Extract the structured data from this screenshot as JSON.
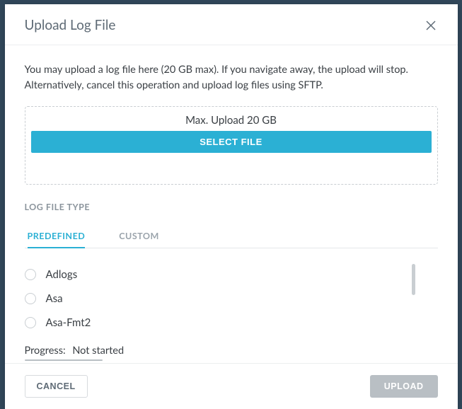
{
  "modal": {
    "title": "Upload Log File",
    "intro": "You may upload a log file here (20 GB max). If you navigate away, the upload will stop. Alternatively, cancel this operation and upload log files using SFTP.",
    "dropzone_hint": "Max. Upload 20 GB",
    "select_file_label": "SELECT FILE",
    "section_label": "LOG FILE TYPE",
    "tabs": {
      "predefined": "PREDEFINED",
      "custom": "CUSTOM"
    },
    "options": {
      "0": "Adlogs",
      "1": "Asa",
      "2": "Asa-Fmt2"
    },
    "progress_label": "Progress:",
    "progress_value": "Not started"
  },
  "footer": {
    "cancel": "CANCEL",
    "upload": "UPLOAD"
  }
}
